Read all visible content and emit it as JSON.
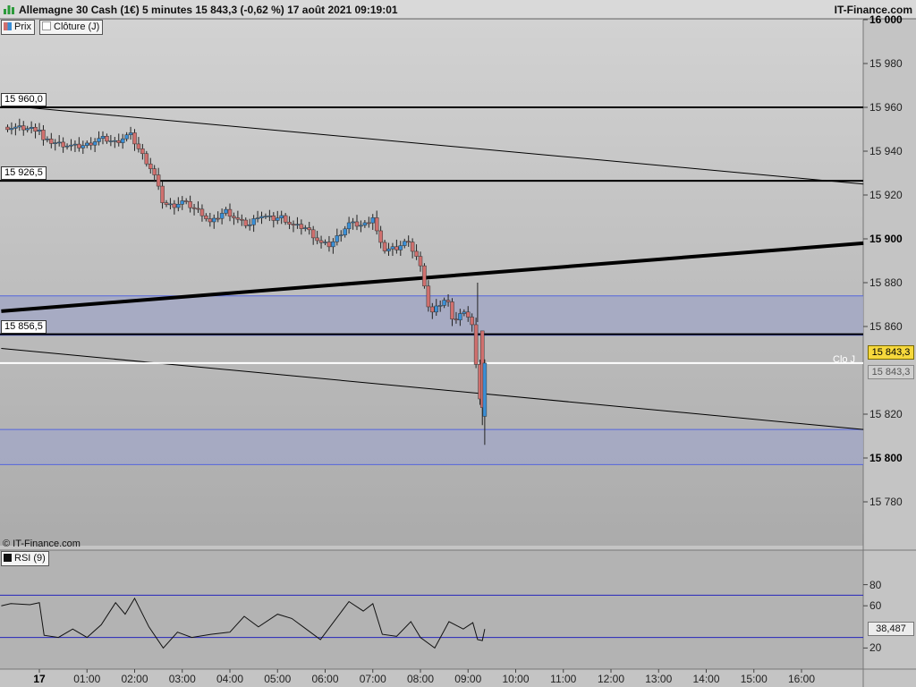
{
  "header": {
    "title": "Allemagne 30 Cash (1€) 5 minutes 15 843,3 (-0,62 %) 17 août 2021 09:19:01",
    "brand": "IT-Finance.com"
  },
  "legend": {
    "prix": "Prix",
    "cloture": "Clôture (J)",
    "rsi": "RSI (9)"
  },
  "copyright": "© IT-Finance.com",
  "levels": [
    {
      "label": "15 960,0",
      "value": 15960
    },
    {
      "label": "15 926,5",
      "value": 15926.5
    },
    {
      "label": "15 856,5",
      "value": 15856.5
    }
  ],
  "badges": {
    "last_price": "15 843,3",
    "prev_close": "15 843,3",
    "close_label": "Clo J",
    "rsi_value": "38,487"
  },
  "colors": {
    "up": "#3a8fd6",
    "down": "#d0706e",
    "zone": "#a3a8c4",
    "zone_line": "#5566dd",
    "rsi_band": "#2424bb",
    "price_badge": "#f6d83c"
  },
  "chart_data": {
    "type": "candlestick",
    "interval": "5 minutes",
    "ylim": [
      15760,
      16000
    ],
    "y_ticks": [
      {
        "label": "16 000",
        "value": 16000,
        "bold": true
      },
      {
        "label": "15 980",
        "value": 15980
      },
      {
        "label": "15 960",
        "value": 15960
      },
      {
        "label": "15 940",
        "value": 15940
      },
      {
        "label": "15 920",
        "value": 15920
      },
      {
        "label": "15 900",
        "value": 15900,
        "bold": true
      },
      {
        "label": "15 880",
        "value": 15880
      },
      {
        "label": "15 860",
        "value": 15860
      },
      {
        "label": "15 820",
        "value": 15820
      },
      {
        "label": "15 800",
        "value": 15800,
        "bold": true
      },
      {
        "label": "15 780",
        "value": 15780
      }
    ],
    "x_ticks": [
      {
        "label": "17",
        "hour": 0,
        "bold": true
      },
      {
        "label": "01:00",
        "hour": 1
      },
      {
        "label": "02:00",
        "hour": 2
      },
      {
        "label": "03:00",
        "hour": 3
      },
      {
        "label": "04:00",
        "hour": 4
      },
      {
        "label": "05:00",
        "hour": 5
      },
      {
        "label": "06:00",
        "hour": 6
      },
      {
        "label": "07:00",
        "hour": 7
      },
      {
        "label": "08:00",
        "hour": 8
      },
      {
        "label": "09:00",
        "hour": 9
      },
      {
        "label": "10:00",
        "hour": 10
      },
      {
        "label": "11:00",
        "hour": 11
      },
      {
        "label": "12:00",
        "hour": 12
      },
      {
        "label": "13:00",
        "hour": 13
      },
      {
        "label": "14:00",
        "hour": 14
      },
      {
        "label": "15:00",
        "hour": 15
      },
      {
        "label": "16:00",
        "hour": 16
      }
    ],
    "x_range_hours": [
      -0.8,
      17.3
    ],
    "prev_close": 15843.3,
    "last_price": 15843.3,
    "zones": [
      [
        15856,
        15874
      ],
      [
        15797,
        15813
      ]
    ],
    "trendlines": [
      {
        "from": [
          -0.8,
          15961
        ],
        "to": [
          17.3,
          15925
        ],
        "width": 1
      },
      {
        "from": [
          -0.8,
          15867
        ],
        "to": [
          17.3,
          15898
        ],
        "width": 4
      },
      {
        "from": [
          -0.8,
          15850
        ],
        "to": [
          17.3,
          15813
        ],
        "width": 1
      }
    ],
    "anchors": [
      [
        -0.75,
        15951
      ],
      [
        0.0,
        15950
      ],
      [
        0.05,
        15945
      ],
      [
        0.3,
        15944
      ],
      [
        0.5,
        15943
      ],
      [
        0.8,
        15942
      ],
      [
        1.0,
        15943
      ],
      [
        1.3,
        15946
      ],
      [
        1.6,
        15944
      ],
      [
        1.9,
        15948
      ],
      [
        2.0,
        15944
      ],
      [
        2.2,
        15937
      ],
      [
        2.4,
        15930
      ],
      [
        2.5,
        15923
      ],
      [
        2.6,
        15916
      ],
      [
        2.8,
        15915
      ],
      [
        3.0,
        15917
      ],
      [
        3.4,
        15912
      ],
      [
        3.6,
        15907
      ],
      [
        3.9,
        15913
      ],
      [
        4.2,
        15908
      ],
      [
        4.4,
        15906
      ],
      [
        4.6,
        15911
      ],
      [
        4.9,
        15909
      ],
      [
        5.1,
        15910
      ],
      [
        5.3,
        15906
      ],
      [
        5.6,
        15905
      ],
      [
        5.9,
        15898
      ],
      [
        6.1,
        15897
      ],
      [
        6.3,
        15902
      ],
      [
        6.5,
        15907
      ],
      [
        6.8,
        15906
      ],
      [
        7.0,
        15910
      ],
      [
        7.1,
        15902
      ],
      [
        7.2,
        15895
      ],
      [
        7.5,
        15896
      ],
      [
        7.7,
        15899
      ],
      [
        7.9,
        15893
      ],
      [
        8.0,
        15887
      ],
      [
        8.1,
        15878
      ],
      [
        8.2,
        15865
      ],
      [
        8.4,
        15870
      ],
      [
        8.55,
        15873
      ],
      [
        8.7,
        15862
      ],
      [
        8.85,
        15866
      ],
      [
        9.0,
        15865
      ],
      [
        9.1,
        15860
      ],
      [
        9.2,
        15833
      ],
      [
        9.3,
        15823
      ],
      [
        9.35,
        15843.3
      ]
    ],
    "rsi": {
      "ylim": [
        0,
        100
      ],
      "bands": [
        70,
        30
      ],
      "ticks": [
        {
          "label": "80",
          "value": 80
        },
        {
          "label": "60",
          "value": 60
        },
        {
          "label": "20",
          "value": 20
        }
      ],
      "last": 38.487,
      "anchors": [
        [
          -0.8,
          60
        ],
        [
          -0.6,
          62
        ],
        [
          -0.2,
          61
        ],
        [
          0.0,
          63
        ],
        [
          0.1,
          32
        ],
        [
          0.4,
          30
        ],
        [
          0.7,
          38
        ],
        [
          1.0,
          30
        ],
        [
          1.3,
          42
        ],
        [
          1.6,
          63
        ],
        [
          1.8,
          52
        ],
        [
          2.0,
          67
        ],
        [
          2.3,
          40
        ],
        [
          2.6,
          20
        ],
        [
          2.9,
          35
        ],
        [
          3.2,
          30
        ],
        [
          3.6,
          33
        ],
        [
          4.0,
          35
        ],
        [
          4.3,
          50
        ],
        [
          4.6,
          40
        ],
        [
          5.0,
          52
        ],
        [
          5.3,
          48
        ],
        [
          5.6,
          38
        ],
        [
          5.9,
          28
        ],
        [
          6.2,
          46
        ],
        [
          6.5,
          64
        ],
        [
          6.8,
          55
        ],
        [
          7.0,
          62
        ],
        [
          7.2,
          33
        ],
        [
          7.5,
          31
        ],
        [
          7.8,
          45
        ],
        [
          8.0,
          30
        ],
        [
          8.3,
          20
        ],
        [
          8.6,
          45
        ],
        [
          8.9,
          38
        ],
        [
          9.1,
          44
        ],
        [
          9.2,
          28
        ],
        [
          9.3,
          27
        ],
        [
          9.35,
          38
        ]
      ]
    }
  }
}
